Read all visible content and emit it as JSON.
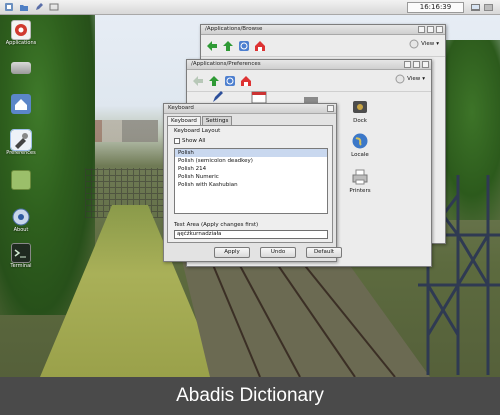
{
  "panel": {
    "clock": "16:16:39"
  },
  "desktop_icons": [
    {
      "label": "Applications",
      "icon": "applications-icon",
      "selected": false
    },
    {
      "label": "",
      "icon": "drive-icon",
      "selected": false
    },
    {
      "label": "",
      "icon": "home-folder-icon",
      "selected": false
    },
    {
      "label": "Preferences",
      "icon": "preferences-icon",
      "selected": true
    },
    {
      "label": "",
      "icon": "folder-icon",
      "selected": false
    },
    {
      "label": "About",
      "icon": "about-icon",
      "selected": false
    },
    {
      "label": "Terminal",
      "icon": "terminal-icon",
      "selected": false
    }
  ],
  "browse_window": {
    "title": "/Applications/Browse",
    "view_label": "View"
  },
  "prefs_window": {
    "title": "/Applications/Preferences",
    "view_label": "View",
    "items": [
      {
        "label": "Dock",
        "icon": "dock-icon"
      },
      {
        "label": "Locale",
        "icon": "locale-globe-icon"
      },
      {
        "label": "Printers",
        "icon": "printer-icon"
      }
    ]
  },
  "keyboard_dialog": {
    "title": "Keyboard",
    "tabs": [
      "Keyboard",
      "Settings"
    ],
    "active_tab": "Keyboard",
    "section_title": "Keyboard Layout",
    "show_all_label": "Show All",
    "show_all_checked": false,
    "layouts": [
      "Polish",
      "Polish (semicolon deadkey)",
      "Polish 214",
      "Polish Numeric",
      "Polish with Kashubian"
    ],
    "selected_layout": "Polish",
    "test_area_label": "Test Area (Apply changes first)",
    "test_value": "ąęćżkurnadziała",
    "buttons": {
      "apply": "Apply",
      "undo": "Undo",
      "default": "Default"
    }
  },
  "caption": "Abadis Dictionary",
  "colors": {
    "caption_bg": "#4a4a4a",
    "selection": "#c9d8ef",
    "window_bg": "#ececec"
  }
}
